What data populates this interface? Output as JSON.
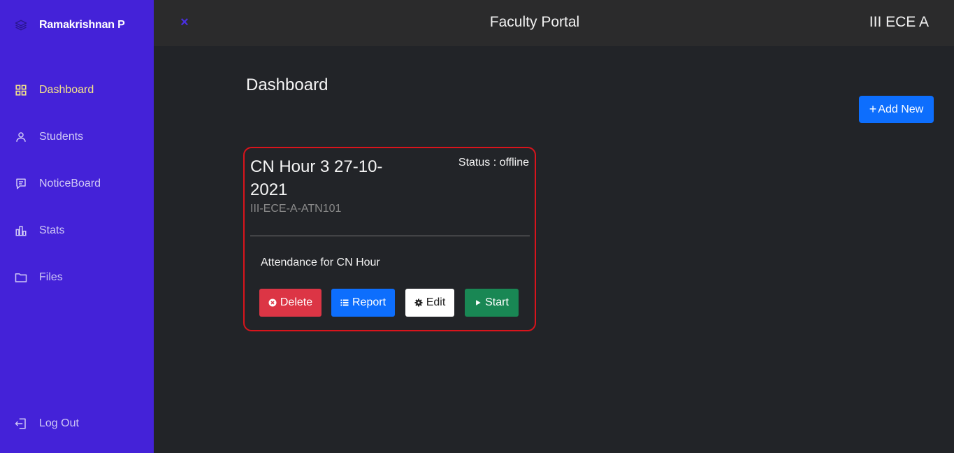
{
  "colors": {
    "sidebar_bg": "#4422d8",
    "page_bg": "#222428",
    "topbar_bg": "#2b2b2c",
    "active_nav": "#f2e28a",
    "card_border": "#d9141c",
    "delete": "#dc3545",
    "primary": "#0d6efd",
    "success": "#198754"
  },
  "sidebar": {
    "user_name": "Ramakrishnan P",
    "user_icon": "layers-icon",
    "items": [
      {
        "label": "Dashboard",
        "icon": "grid-icon",
        "active": true
      },
      {
        "label": "Students",
        "icon": "user-icon",
        "active": false
      },
      {
        "label": "NoticeBoard",
        "icon": "message-icon",
        "active": false
      },
      {
        "label": "Stats",
        "icon": "bar-chart-icon",
        "active": false
      },
      {
        "label": "Files",
        "icon": "folder-icon",
        "active": false
      }
    ],
    "logout_label": "Log Out",
    "logout_icon": "logout-icon"
  },
  "topbar": {
    "close_symbol": "×",
    "title": "Faculty Portal",
    "class_name": "III ECE A"
  },
  "main": {
    "title": "Dashboard",
    "add_button": {
      "symbol": "+",
      "label": "Add New"
    },
    "card": {
      "title": "CN Hour 3 27-10-2021",
      "code": "III-ECE-A-ATN101",
      "status": "Status : offline",
      "description": "Attendance for CN Hour",
      "buttons": {
        "delete": "Delete",
        "report": "Report",
        "edit": "Edit",
        "start": "Start"
      }
    }
  }
}
